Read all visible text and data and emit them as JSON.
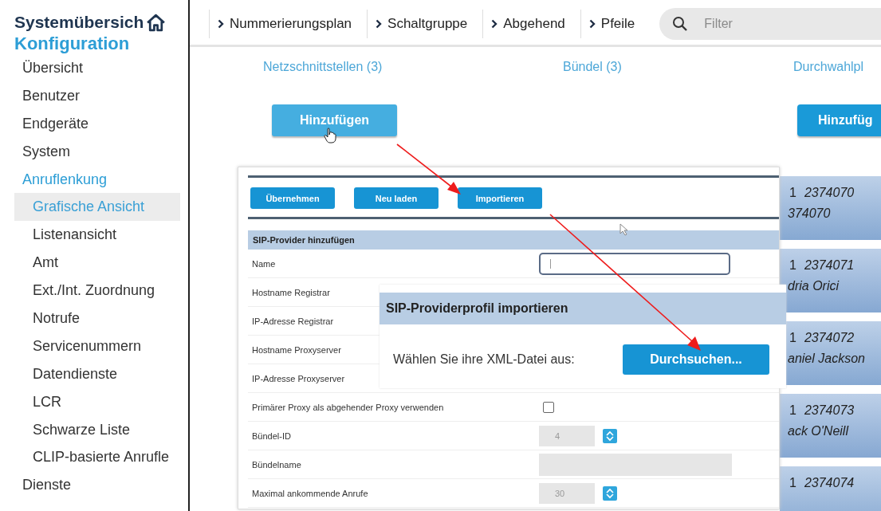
{
  "sidebar": {
    "title": "Systemübersich",
    "section": "Konfiguration",
    "items": [
      {
        "label": "Übersicht",
        "selected": false
      },
      {
        "label": "Benutzer",
        "selected": false
      },
      {
        "label": "Endgeräte",
        "selected": false
      },
      {
        "label": "System",
        "selected": false
      },
      {
        "label": "Anruflenkung",
        "selected": false,
        "expanded": true,
        "children": [
          {
            "label": "Grafische Ansicht",
            "selected": true
          },
          {
            "label": "Listenansicht",
            "selected": false
          },
          {
            "label": "Amt",
            "selected": false
          },
          {
            "label": "Ext./Int. Zuordnung",
            "selected": false
          },
          {
            "label": "Notrufe",
            "selected": false
          },
          {
            "label": "Servicenummern",
            "selected": false
          },
          {
            "label": "Datendienste",
            "selected": false
          },
          {
            "label": "LCR",
            "selected": false
          },
          {
            "label": "Schwarze Liste",
            "selected": false
          },
          {
            "label": "CLIP-basierte Anrufle",
            "selected": false
          }
        ]
      },
      {
        "label": "Dienste",
        "selected": false
      }
    ]
  },
  "nav": {
    "items": [
      "Nummerierungsplan",
      "Schaltgruppe",
      "Abgehend",
      "Pfeile"
    ],
    "filter": {
      "placeholder": "Filter"
    }
  },
  "columns": [
    "Netzschnittstellen (3)",
    "Bündel (3)",
    "Durchwahlpl"
  ],
  "add_buttons": [
    "Hinzufügen",
    "Hinzufüg"
  ],
  "form": {
    "buttons": [
      "Übernehmen",
      "Neu laden",
      "Importieren"
    ],
    "title": "SIP-Provider hinzufügen",
    "rows": [
      {
        "label": "Name",
        "kind": "input"
      },
      {
        "label": "Hostname Registrar",
        "kind": "text"
      },
      {
        "label": "IP-Adresse Registrar",
        "kind": "text"
      },
      {
        "label": "Hostname Proxyserver",
        "kind": "text"
      },
      {
        "label": "IP-Adresse Proxyserver",
        "kind": "text"
      },
      {
        "label": "Primärer Proxy als abgehender Proxy verwenden",
        "kind": "checkbox",
        "checked": false
      },
      {
        "label": "Bündel-ID",
        "kind": "spinner",
        "value": "4"
      },
      {
        "label": "Bündelname",
        "kind": "field"
      },
      {
        "label": "Maximal ankommende Anrufe",
        "kind": "spinner",
        "value": "30"
      }
    ]
  },
  "dialog": {
    "title": "SIP-Providerprofil importieren",
    "prompt": "Wählen Sie ihre XML-Datei aus:",
    "button": "Durchsuchen..."
  },
  "cards": [
    {
      "index": "1",
      "number": "2374070",
      "name": "374070"
    },
    {
      "index": "1",
      "number": "2374071",
      "name": "dria Orici"
    },
    {
      "index": "1",
      "number": "2374072",
      "name": "aniel Jackson"
    },
    {
      "index": "1",
      "number": "2374073",
      "name": "ack O'Neill"
    },
    {
      "index": "1",
      "number": "2374074"
    }
  ]
}
